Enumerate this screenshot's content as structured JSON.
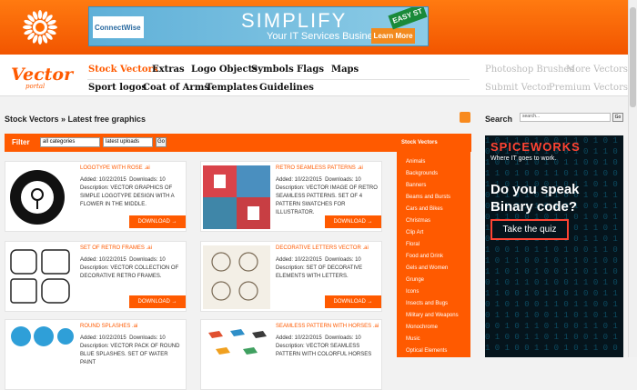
{
  "ad_banner": {
    "brand": "ConnectWise",
    "headline": "SIMPLIFY",
    "subline": "Your IT Services Business",
    "cta": "Learn More",
    "sign": "EASY ST"
  },
  "logo": {
    "main": "Vector",
    "sub": "portal"
  },
  "nav": {
    "row1": [
      "Stock Vectors",
      "Extras",
      "Logo Objects",
      "Symbols",
      "Flags",
      "Maps"
    ],
    "row2": [
      "Sport logos",
      "Coat of Arms",
      "Templates",
      "Guidelines"
    ],
    "right1": [
      "Photoshop Brushes",
      "More Vectors"
    ],
    "right2": [
      "Submit Vector",
      "Premium Vectors"
    ]
  },
  "breadcrumb": "Stock Vectors » Latest free graphics",
  "filter": {
    "label": "Filter",
    "category": "all categories",
    "sort": "latest uploads",
    "go": "Go"
  },
  "cards": [
    {
      "title": "LOGOTYPE WITH ROSE",
      "ext": ".ai",
      "added": "Added: 10/22/2015",
      "downloads": "Downloads: 10",
      "desc": "Description: VECTOR GRAPHICS OF SIMPLE LOGOTYPE DESIGN WITH A FLOWER IN THE MIDDLE.",
      "download": "DOWNLOAD →"
    },
    {
      "title": "RETRO SEAMLESS PATTERNS",
      "ext": ".ai",
      "added": "Added: 10/22/2015",
      "downloads": "Downloads: 10",
      "desc": "Description: VECTOR IMAGE OF RETRO SEAMLESS PATTERNS. SET OF 4 PATTERN SWATCHES FOR ILLUSTRATOR.",
      "download": "DOWNLOAD →"
    },
    {
      "title": "SET OF RETRO FRAMES",
      "ext": ".ai",
      "added": "Added: 10/22/2015",
      "downloads": "Downloads: 10",
      "desc": "Description: VECTOR COLLECTION OF DECORATIVE RETRO FRAMES.",
      "download": "DOWNLOAD →"
    },
    {
      "title": "DECORATIVE LETTERS VECTOR",
      "ext": ".ai",
      "added": "Added: 10/22/2015",
      "downloads": "Downloads: 10",
      "desc": "Description: SET OF DECORATIVE ELEMENTS WITH LETTERS.",
      "download": "DOWNLOAD →"
    },
    {
      "title": "ROUND SPLASHES",
      "ext": ".ai",
      "added": "Added: 10/22/2015",
      "downloads": "Downloads: 10",
      "desc": "Description: VECTOR PACK OF ROUND BLUE SPLASHES. SET OF WATER PAINT",
      "download": "DOWNLOAD →"
    },
    {
      "title": "SEAMLESS PATTERN WITH HORSES",
      "ext": ".ai",
      "added": "Added: 10/22/2015",
      "downloads": "Downloads: 10",
      "desc": "Description: VECTOR SEAMLESS PATTERN WITH COLORFUL HORSES",
      "download": "DOWNLOAD →"
    }
  ],
  "categories": {
    "heading": "Stock Vectors",
    "items": [
      "Animals",
      "Backgrounds",
      "Banners",
      "Beams and Bursts",
      "Cars and Bikes",
      "Christmas",
      "Clip Art",
      "Floral",
      "Food and Drink",
      "Gels and Women",
      "Grunge",
      "Icons",
      "Insects and Bugs",
      "Military and Weapons",
      "Monochrome",
      "Music",
      "Optical Elements"
    ]
  },
  "search": {
    "label": "Search",
    "placeholder": "search...",
    "go": "Go"
  },
  "ad_side": {
    "brand": "SPICEWORKS",
    "tagline": "Where IT goes to work.",
    "headline": "Do you speak Binary code?",
    "cta": "Take the quiz"
  },
  "colors": {
    "brand": "#ff5a00"
  }
}
